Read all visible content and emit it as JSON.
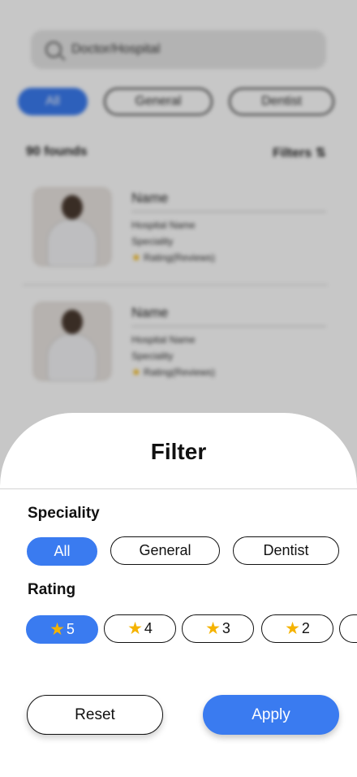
{
  "background": {
    "search": {
      "placeholder": "Doctor/Hospital"
    },
    "chips": [
      "All",
      "General",
      "Dentist"
    ],
    "results_count": "90 founds",
    "filters_label": "Filters",
    "cards": [
      {
        "name": "Name",
        "hospital": "Hospital Name",
        "speciality": "Speciality",
        "rating": "Rating(Reviews)"
      },
      {
        "name": "Name",
        "hospital": "Hospital Name",
        "speciality": "Speciality",
        "rating": "Rating(Reviews)"
      }
    ]
  },
  "sheet": {
    "title": "Filter",
    "speciality_label": "Speciality",
    "speciality_options": [
      "All",
      "General",
      "Dentist"
    ],
    "rating_label": "Rating",
    "rating_options": [
      "5",
      "4",
      "3",
      "2"
    ],
    "reset_label": "Reset",
    "apply_label": "Apply"
  },
  "colors": {
    "accent": "#3a7bf0",
    "star": "#f5b301"
  },
  "icons": {
    "search": "search-icon",
    "filters": "filter-icon",
    "rating": "star-icon"
  }
}
